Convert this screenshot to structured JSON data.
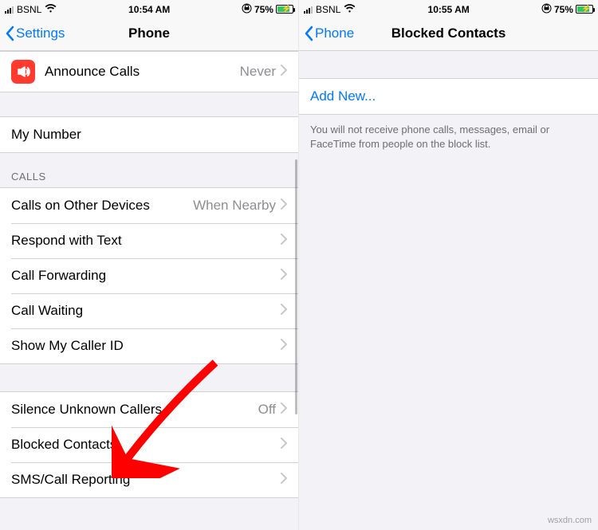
{
  "left": {
    "status": {
      "carrier": "BSNL",
      "time": "10:54 AM",
      "battery": "75%"
    },
    "nav": {
      "back": "Settings",
      "title": "Phone"
    },
    "announce": {
      "label": "Announce Calls",
      "value": "Never"
    },
    "my_number": {
      "label": "My Number"
    },
    "calls_header": "Calls",
    "calls": {
      "other_devices": {
        "label": "Calls on Other Devices",
        "value": "When Nearby"
      },
      "respond": {
        "label": "Respond with Text"
      },
      "forwarding": {
        "label": "Call Forwarding"
      },
      "waiting": {
        "label": "Call Waiting"
      },
      "caller_id": {
        "label": "Show My Caller ID"
      }
    },
    "more": {
      "silence": {
        "label": "Silence Unknown Callers",
        "value": "Off"
      },
      "blocked": {
        "label": "Blocked Contacts"
      },
      "sms": {
        "label": "SMS/Call Reporting"
      }
    }
  },
  "right": {
    "status": {
      "carrier": "BSNL",
      "time": "10:55 AM",
      "battery": "75%"
    },
    "nav": {
      "back": "Phone",
      "title": "Blocked Contacts"
    },
    "add_new": "Add New...",
    "footer": "You will not receive phone calls, messages, email or FaceTime from people on the block list."
  },
  "watermark": "wsxdn.com"
}
